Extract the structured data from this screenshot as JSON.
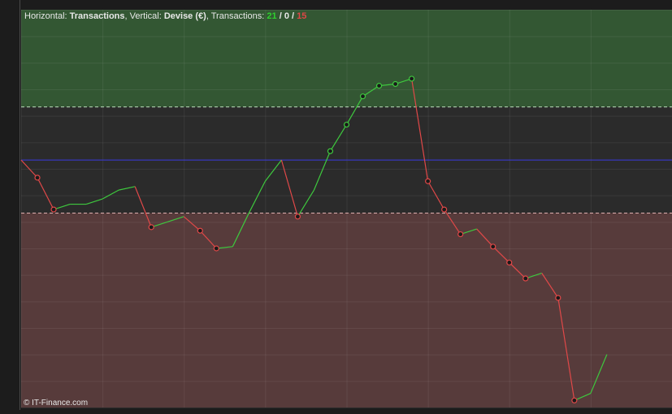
{
  "header": {
    "horizontal_label": "Horizontal:",
    "horizontal_value": "Transactions",
    "sep1": ", ",
    "vertical_label": "Vertical:",
    "vertical_value": "Devise (€)",
    "sep2": ", ",
    "transactions_label": "Transactions:",
    "count_win": "21",
    "slash1": " / ",
    "count_neutral": "0",
    "slash2": " / ",
    "count_loss": "15"
  },
  "footer": {
    "copyright": "© IT-Finance.com"
  },
  "colors": {
    "background": "#1c1c1c",
    "plot_bg": "#2b2b2b",
    "upper_zone": "#335733",
    "lower_zone": "#573b3b",
    "win_line": "#3ec83e",
    "loss_line": "#e04848",
    "baseline": "#3a3ae0",
    "grid": "#3a3a3a"
  },
  "chart_data": {
    "type": "line",
    "xlabel": "Transactions",
    "ylabel": "Devise (€)",
    "xlim": [
      0,
      40
    ],
    "ylim": [
      -140,
      85
    ],
    "baseline": 0,
    "upper_threshold": 30,
    "lower_threshold": -30,
    "grid": true,
    "equity_curve": [
      {
        "x": 0,
        "y": 0
      },
      {
        "x": 1,
        "y": -10
      },
      {
        "x": 2,
        "y": -28
      },
      {
        "x": 3,
        "y": -25
      },
      {
        "x": 4,
        "y": -25
      },
      {
        "x": 5,
        "y": -22
      },
      {
        "x": 6,
        "y": -17
      },
      {
        "x": 7,
        "y": -15
      },
      {
        "x": 8,
        "y": -38
      },
      {
        "x": 9,
        "y": -35
      },
      {
        "x": 10,
        "y": -32
      },
      {
        "x": 11,
        "y": -40
      },
      {
        "x": 12,
        "y": -50
      },
      {
        "x": 13,
        "y": -49
      },
      {
        "x": 14,
        "y": -30
      },
      {
        "x": 15,
        "y": -12
      },
      {
        "x": 16,
        "y": 0
      },
      {
        "x": 17,
        "y": -32
      },
      {
        "x": 18,
        "y": -17
      },
      {
        "x": 19,
        "y": 5
      },
      {
        "x": 20,
        "y": 20
      },
      {
        "x": 21,
        "y": 36
      },
      {
        "x": 22,
        "y": 42
      },
      {
        "x": 23,
        "y": 43
      },
      {
        "x": 24,
        "y": 46
      },
      {
        "x": 25,
        "y": -12
      },
      {
        "x": 26,
        "y": -28
      },
      {
        "x": 27,
        "y": -42
      },
      {
        "x": 28,
        "y": -39
      },
      {
        "x": 29,
        "y": -49
      },
      {
        "x": 30,
        "y": -58
      },
      {
        "x": 31,
        "y": -67
      },
      {
        "x": 32,
        "y": -64
      },
      {
        "x": 33,
        "y": -78
      },
      {
        "x": 34,
        "y": -136
      },
      {
        "x": 35,
        "y": -132
      },
      {
        "x": 36,
        "y": -110
      }
    ]
  }
}
